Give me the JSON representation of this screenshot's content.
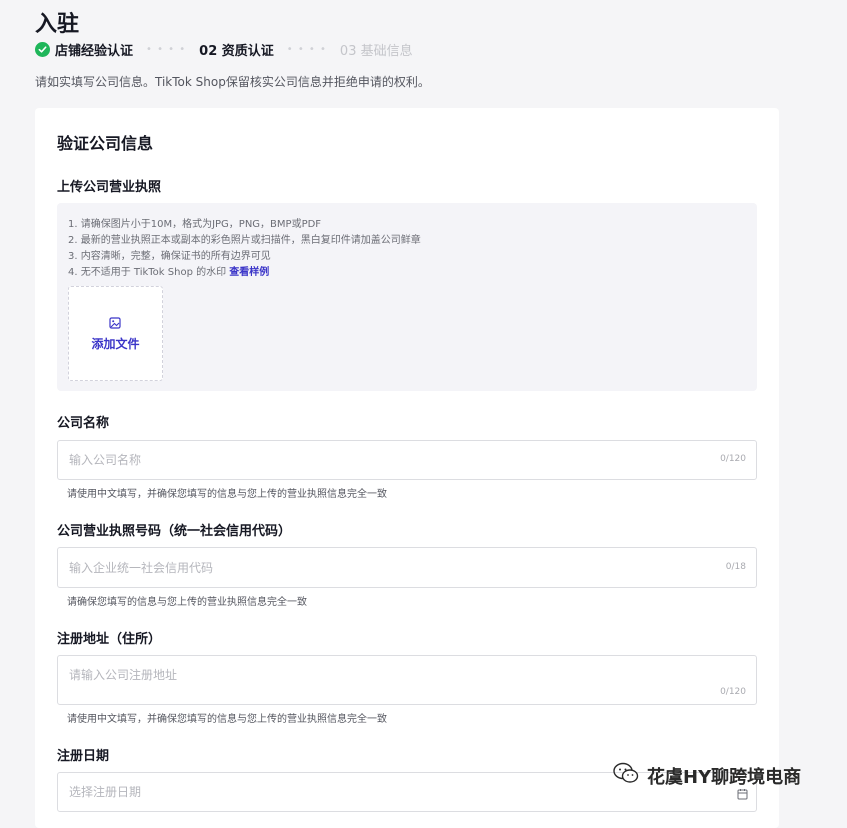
{
  "page": {
    "title": "入驻",
    "notice": "请如实填写公司信息。TikTok Shop保留核实公司信息并拒绝申请的权利。"
  },
  "steps": [
    {
      "label": "店铺经验认证",
      "state": "done"
    },
    {
      "label": "02 资质认证",
      "state": "current"
    },
    {
      "label": "03 基础信息",
      "state": "todo"
    }
  ],
  "card": {
    "title": "验证公司信息",
    "upload": {
      "label": "上传公司营业执照",
      "rules": [
        "1. 请确保图片小于10M，格式为JPG，PNG，BMP或PDF",
        "2. 最新的营业执照正本或副本的彩色照片或扫描件，黑白复印件请加盖公司鲜章",
        "3. 内容清晰，完整，确保证书的所有边界可见",
        "4. 无不适用于 TikTok Shop 的水印 "
      ],
      "sample_link": "查看样例",
      "add_button": "添加文件",
      "icon": "image-icon"
    },
    "company_name": {
      "label": "公司名称",
      "placeholder": "输入公司名称",
      "value": "",
      "counter": "0/120",
      "hint": "请使用中文填写，并确保您填写的信息与您上传的营业执照信息完全一致"
    },
    "license_number": {
      "label": "公司营业执照号码（统一社会信用代码）",
      "placeholder": "输入企业统一社会信用代码",
      "value": "",
      "counter": "0/18",
      "hint": "请确保您填写的信息与您上传的营业执照信息完全一致"
    },
    "address": {
      "label": "注册地址（住所）",
      "placeholder": "请输入公司注册地址",
      "value": "",
      "counter": "0/120",
      "hint": "请使用中文填写，并确保您填写的信息与您上传的营业执照信息完全一致"
    },
    "registration_date": {
      "label": "注册日期",
      "placeholder": "选择注册日期",
      "icon": "calendar-icon"
    }
  },
  "watermark": {
    "text": "花虞HY聊跨境电商",
    "icon": "wechat-icon"
  },
  "colors": {
    "accent": "#3b35c8",
    "success": "#1fb65a",
    "background": "#f5f5f7"
  }
}
